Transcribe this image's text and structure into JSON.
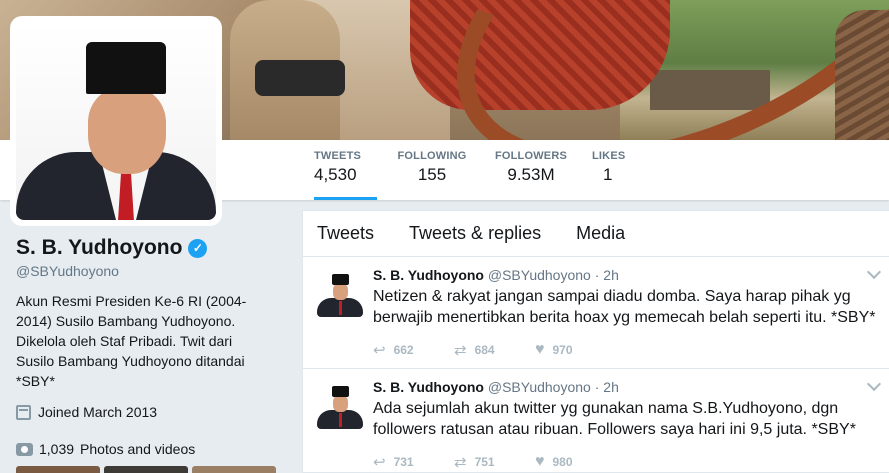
{
  "profile": {
    "name": "S. B. Yudhoyono",
    "handle": "@SBYudhoyono",
    "bio": "Akun Resmi Presiden Ke-6 RI (2004-2014) Susilo Bambang Yudhoyono. Dikelola oleh Staf Pribadi. Twit dari Susilo Bambang Yudhoyono ditandai *SBY*",
    "joined": "Joined March 2013",
    "photos_count": "1,039",
    "photos_label": "Photos and videos"
  },
  "stats": [
    {
      "label": "TWEETS",
      "value": "4,530"
    },
    {
      "label": "FOLLOWING",
      "value": "155"
    },
    {
      "label": "FOLLOWERS",
      "value": "9.53M"
    },
    {
      "label": "LIKES",
      "value": "1"
    }
  ],
  "tabs": [
    "Tweets",
    "Tweets & replies",
    "Media"
  ],
  "tweets": [
    {
      "name": "S. B. Yudhoyono",
      "handle": "@SBYudhoyono",
      "dot": "·",
      "time": "2h",
      "text": "Netizen & rakyat jangan sampai diadu domba. Saya harap pihak yg berwajib menertibkan berita hoax yg memecah belah seperti itu. *SBY*",
      "replies": "662",
      "retweets": "684",
      "likes": "970"
    },
    {
      "name": "S. B. Yudhoyono",
      "handle": "@SBYudhoyono",
      "dot": "·",
      "time": "2h",
      "text": "Ada sejumlah akun twitter yg gunakan nama S.B.Yudhoyono, dgn followers ratusan atau ribuan. Followers saya hari ini 9,5 juta. *SBY*",
      "replies": "731",
      "retweets": "751",
      "likes": "980"
    }
  ],
  "icons": {
    "verified": "verified-check-icon",
    "reply": "reply-icon",
    "retweet": "retweet-icon",
    "like": "heart-icon",
    "calendar": "calendar-icon",
    "camera": "camera-icon"
  },
  "colors": {
    "accent": "#1da1f2",
    "text": "#14171a",
    "muted": "#657786",
    "background": "#e6ecf0"
  }
}
